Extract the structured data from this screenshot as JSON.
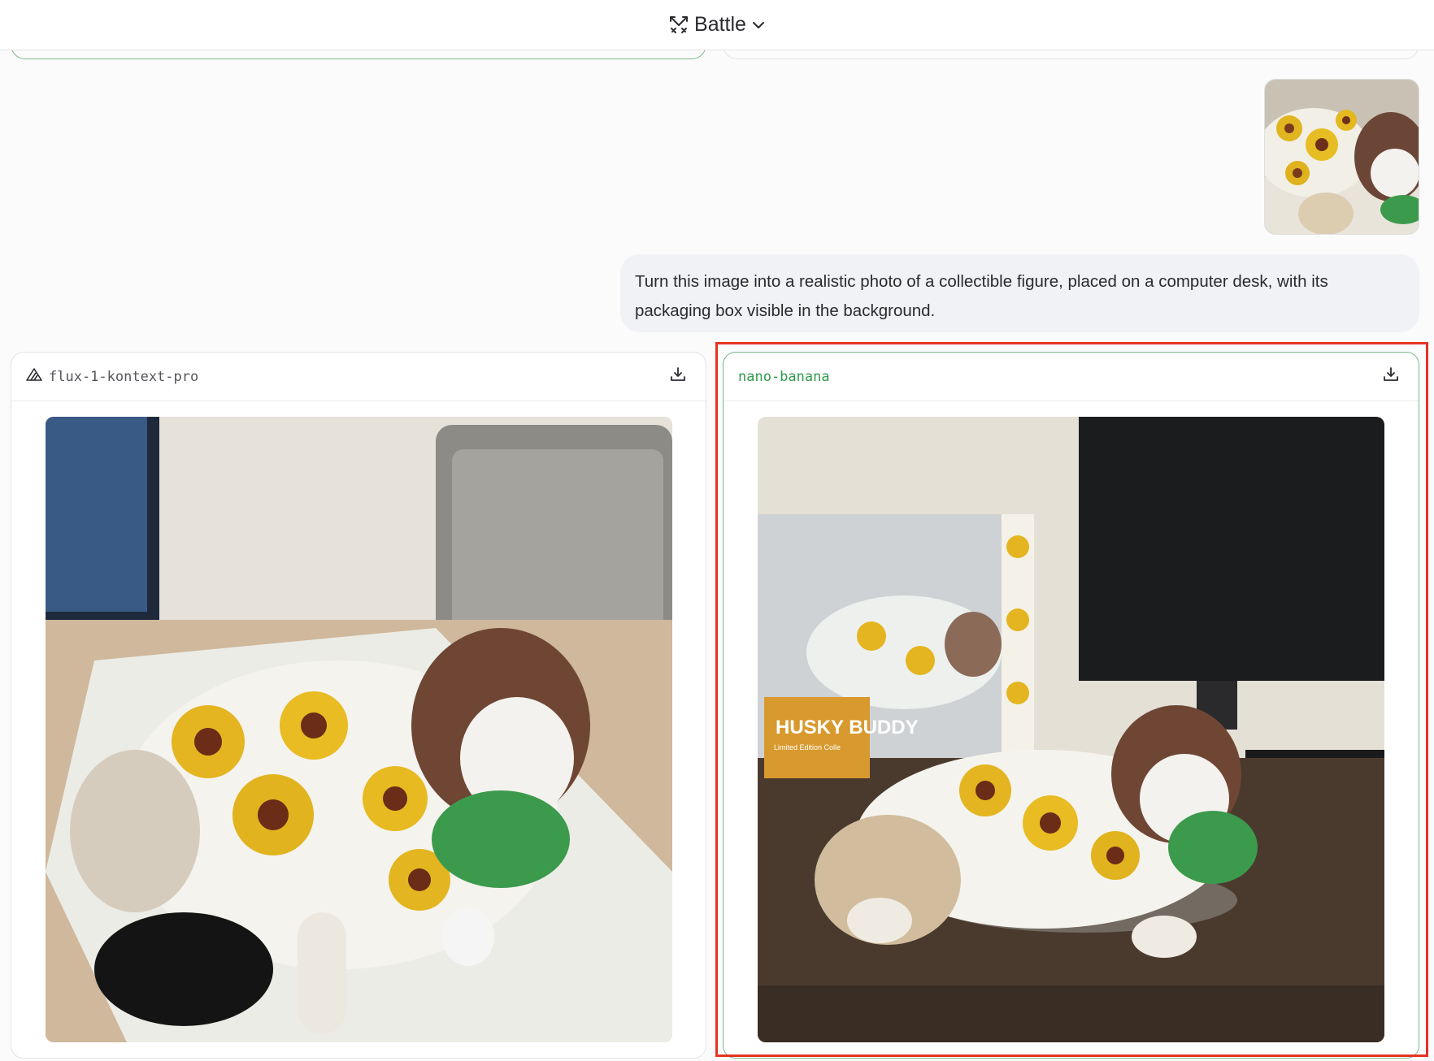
{
  "header": {
    "mode_label": "Battle",
    "mode_icon": "swords-icon",
    "dropdown_icon": "chevron-down-icon"
  },
  "conversation": {
    "attachment": {
      "kind": "image",
      "description_icon": "image-thumbnail"
    },
    "prompt": "Turn this image into a realistic photo of a collectible figure, placed on a computer desk, with its packaging box visible in the background."
  },
  "responses": [
    {
      "model": "flux-1-kontext-pro",
      "model_icon": "triangle-logo-icon",
      "download_icon": "download-icon",
      "accent": "#55555c"
    },
    {
      "model": "nano-banana",
      "download_icon": "download-icon",
      "accent": "#2f9a4d",
      "packaging_text": "HUSKY BUDDY",
      "packaging_subtext": "Limited Edition Colle"
    }
  ],
  "colors": {
    "selection_outline": "#e53422",
    "card_border_right": "#79b98a",
    "prompt_bg": "#f1f2f5"
  }
}
